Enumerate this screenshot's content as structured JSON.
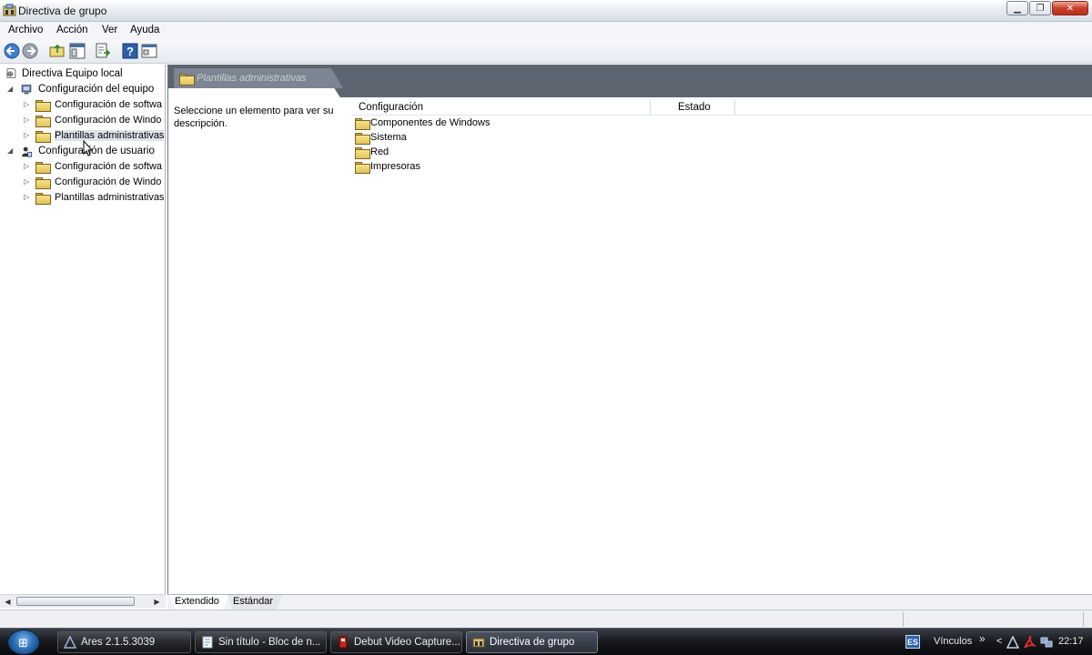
{
  "window": {
    "title": "Directiva de grupo",
    "controls": {
      "minimize": "▁",
      "maximize": "❐",
      "close": "✕"
    }
  },
  "menu": [
    "Archivo",
    "Acción",
    "Ver",
    "Ayuda"
  ],
  "toolbar": {
    "buttons": [
      "back-arrow-icon",
      "forward-arrow-icon",
      "up-folder-icon",
      "show-hide-tree-icon",
      "export-list-icon",
      "help-icon",
      "properties-icon"
    ],
    "help_glyph": "?"
  },
  "tree": {
    "root": "Directiva Equipo local",
    "computer": "Configuración del equipo",
    "computer_children": [
      "Configuración de softwa",
      "Configuración de Windo",
      "Plantillas administrativas"
    ],
    "user": "Configuración de usuario",
    "user_children": [
      "Configuración de softwa",
      "Configuración de Windo",
      "Plantillas administrativas"
    ]
  },
  "right": {
    "header_tab": "Plantillas administrativas",
    "description": "Seleccione un elemento para ver su descripción.",
    "columns": [
      "Configuración",
      "Estado"
    ],
    "items": [
      "Componentes de Windows",
      "Sistema",
      "Red",
      "Impresoras"
    ]
  },
  "view_tabs": [
    "Extendido",
    "Estándar"
  ],
  "taskbar": {
    "buttons": [
      "Ares 2.1.5.3039",
      "Sin título - Bloc de n...",
      "Debut Video Capture...",
      "Directiva de grupo"
    ],
    "language": "ES",
    "links_label": "Vínculos",
    "links_chevron": "»",
    "tray_chevron": "<",
    "clock": "22:17"
  },
  "colors": {
    "header_dark": "#5d6570",
    "folder_yellow": "#f6e28a",
    "taskbar_dark": "#16181c"
  }
}
